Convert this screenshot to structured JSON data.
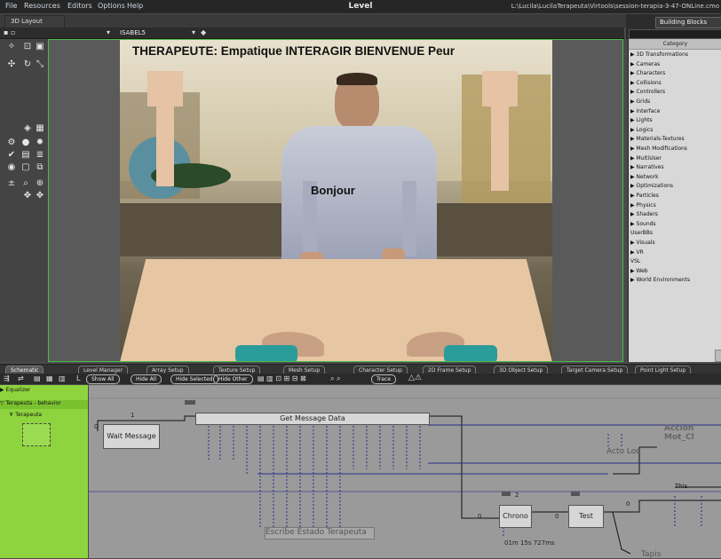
{
  "menu": [
    "File",
    "Resources",
    "Editors",
    "Options",
    "Help"
  ],
  "app_title": "Level",
  "file_path": "L:\\Lucila\\LucilaTerapeuta\\Virtools\\session-terapia-3-47-ONLine.cmo",
  "layout_tab": "3D Layout",
  "camera_select": "ISABEL5",
  "scene": {
    "banner": "THERAPEUTE: Empatique  INTERAGIR  BIENVENUE  Peur",
    "speech": "Bonjour"
  },
  "building_blocks": {
    "tab": "Building Blocks",
    "header": "Category",
    "items": [
      "3D Transformations",
      "Cameras",
      "Characters",
      "Collisions",
      "Controllers",
      "Grids",
      "Interface",
      "Lights",
      "Logics",
      "Materials-Textures",
      "Mesh Modifications",
      "MultiUser",
      "Narratives",
      "Network",
      "Optimizations",
      "Particles",
      "Physics",
      "Shaders",
      "Sounds",
      "UserBBs",
      "Visuals",
      "VR",
      "VSL",
      "Web",
      "World Environments"
    ]
  },
  "tabs": [
    "Schematic",
    "Level Manager",
    "Array Setup",
    "Texture Setup",
    "Mesh Setup",
    "Character Setup",
    "2D Frame Setup",
    "3D Object Setup",
    "Target Camera Setup",
    "Point Light Setup"
  ],
  "toolbar_buttons": [
    "Show All",
    "Hide All",
    "Hide Selected",
    "Hide Other",
    "Trace"
  ],
  "schematic_tree": {
    "item1": "Equalizer",
    "item2": "Terapeuta - behavior",
    "item3": "Terapeuta"
  },
  "blocks": {
    "wait": "Wait Message",
    "getmsg": "Get Message Data",
    "accion": "Accion Mot_Cl",
    "acto": "Acto Loc",
    "escribe": "Escribe Estado Terapeuta",
    "chrono": "Chrono",
    "test": "Test",
    "tapis": "Tapis",
    "this": "This",
    "timer": "01m 15s 727ms"
  },
  "link_labels": {
    "l1": "1",
    "l0a": "0",
    "l2": "2",
    "l0b": "0",
    "l0c": "0",
    "l0d": "0"
  }
}
